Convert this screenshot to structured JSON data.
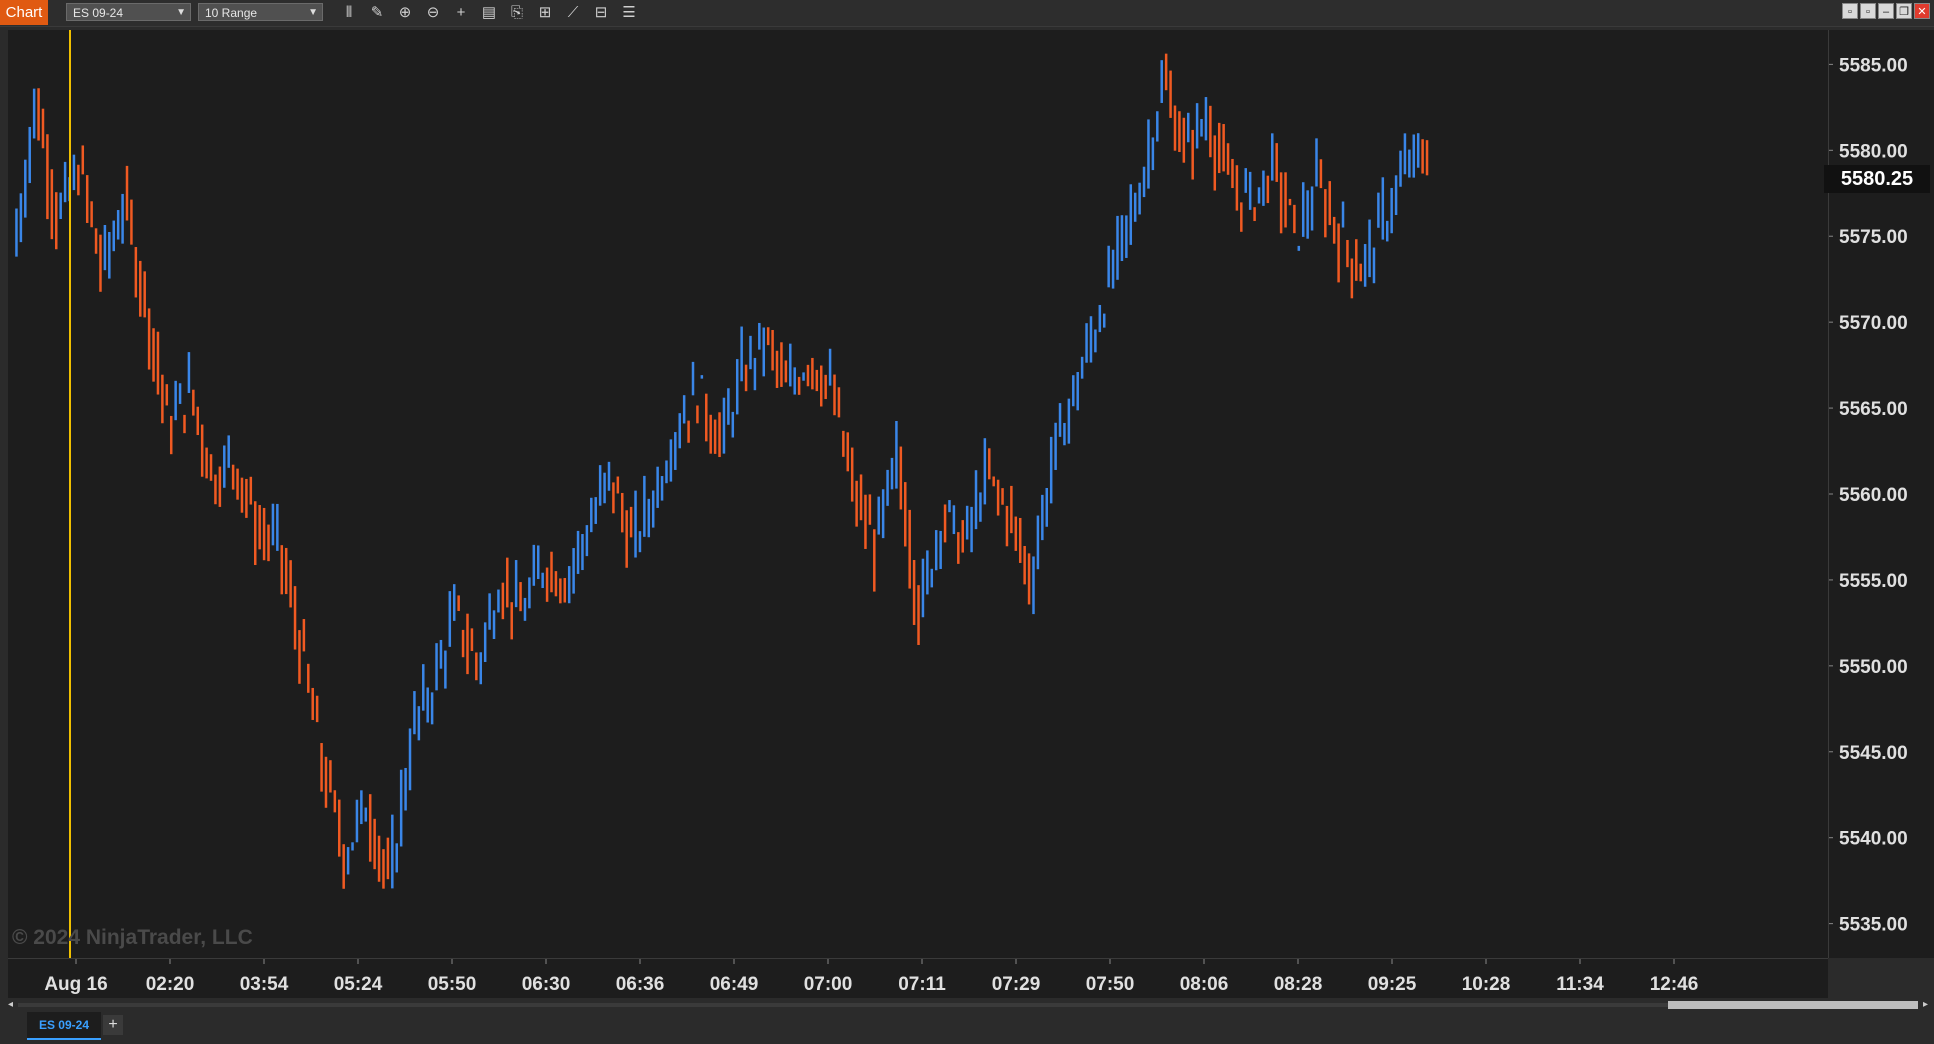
{
  "window": {
    "tab_label": "Chart",
    "instrument": "ES 09-24",
    "period": "10 Range"
  },
  "toolbar": {
    "icons": [
      "bar-type-icon",
      "pencil-icon",
      "zoom-in-icon",
      "zoom-out-icon",
      "crosshair-icon",
      "properties-icon",
      "templates-icon",
      "indicators-icon",
      "strategies-icon",
      "chart-trader-icon",
      "data-box-icon"
    ]
  },
  "chart": {
    "copyright": "© 2024 NinjaTrader, LLC",
    "current_price": "5580.25",
    "price_labels": [
      "5585.00",
      "5580.00",
      "5575.00",
      "5570.00",
      "5565.00",
      "5560.00",
      "5555.00",
      "5550.00",
      "5545.00",
      "5540.00",
      "5535.00"
    ],
    "time_labels": [
      "Aug 16",
      "02:20",
      "03:54",
      "05:24",
      "05:50",
      "06:30",
      "06:36",
      "06:49",
      "07:00",
      "07:11",
      "07:29",
      "07:50",
      "08:06",
      "08:28",
      "09:25",
      "10:28",
      "11:34",
      "12:46"
    ],
    "colors": {
      "up": "#3a86e8",
      "down": "#f05a22",
      "session_line": "#f0c000",
      "background": "#1d1d1d",
      "axis_text": "#e0e0e0"
    }
  },
  "chart_data": {
    "type": "bar",
    "series": [
      {
        "name": "ES 09-24",
        "close_path": [
          5574,
          5583,
          5576,
          5579,
          5573,
          5577,
          5571,
          5564,
          5566,
          5561,
          5562,
          5558,
          5557,
          5551,
          5544,
          5539,
          5542,
          5537,
          5546,
          5549,
          5553,
          5550,
          5555,
          5553,
          5556,
          5555,
          5558,
          5561,
          5557,
          5560,
          5564,
          5566,
          5563,
          5567,
          5569,
          5566,
          5568,
          5566,
          5560,
          5557,
          5562,
          5553,
          5559,
          5557,
          5561,
          5559,
          5555,
          5562,
          5566,
          5570,
          5574,
          5578,
          5584,
          5580,
          5582,
          5578,
          5577,
          5579,
          5575,
          5578,
          5575,
          5573,
          5576,
          5579,
          5580
        ]
      }
    ],
    "ylim": [
      5533,
      5587
    ]
  }
}
